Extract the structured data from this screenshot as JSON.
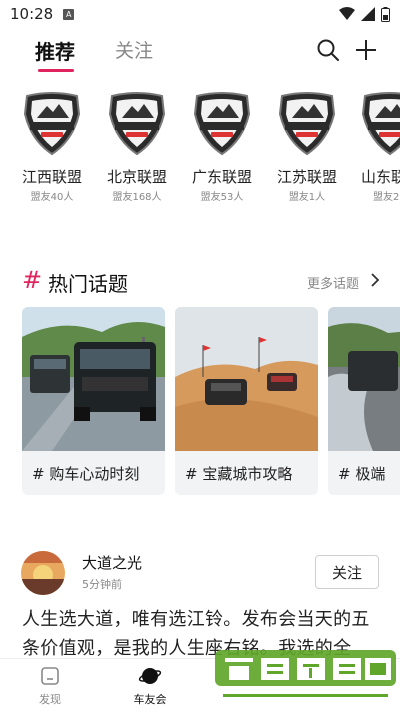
{
  "status_bar": {
    "time": "10:28",
    "sim_label": "A"
  },
  "top_nav": {
    "tabs": [
      {
        "label": "推荐",
        "active": true
      },
      {
        "label": "关注",
        "active": false
      }
    ],
    "icons": [
      "search-icon",
      "add-icon"
    ],
    "accent_color": "#e0245e"
  },
  "clubs": [
    {
      "name": "江西联盟",
      "members": "盟友40人"
    },
    {
      "name": "北京联盟",
      "members": "盟友168人"
    },
    {
      "name": "广东联盟",
      "members": "盟友53人"
    },
    {
      "name": "江苏联盟",
      "members": "盟友1人"
    },
    {
      "name": "山东联盟",
      "members": "盟友2"
    }
  ],
  "hot_topics": {
    "title": "热门话题",
    "more_label": "更多话题",
    "items": [
      {
        "label": "# 购车心动时刻"
      },
      {
        "label": "# 宝藏城市攻略"
      },
      {
        "label": "# 极端"
      }
    ]
  },
  "post": {
    "author": "大道之光",
    "time": "5分钟前",
    "follow_label": "关注",
    "text": "人生选大道，唯有选江铃。发布会当天的五条价值观，是我的人生座右铭。我选的全能，人"
  },
  "bottom_tabs": [
    {
      "label": "发现",
      "active": false
    },
    {
      "label": "车友会",
      "active": true
    }
  ],
  "watermark": {
    "title": "谷普软件园",
    "url": "www.gupuxiazai.com"
  }
}
